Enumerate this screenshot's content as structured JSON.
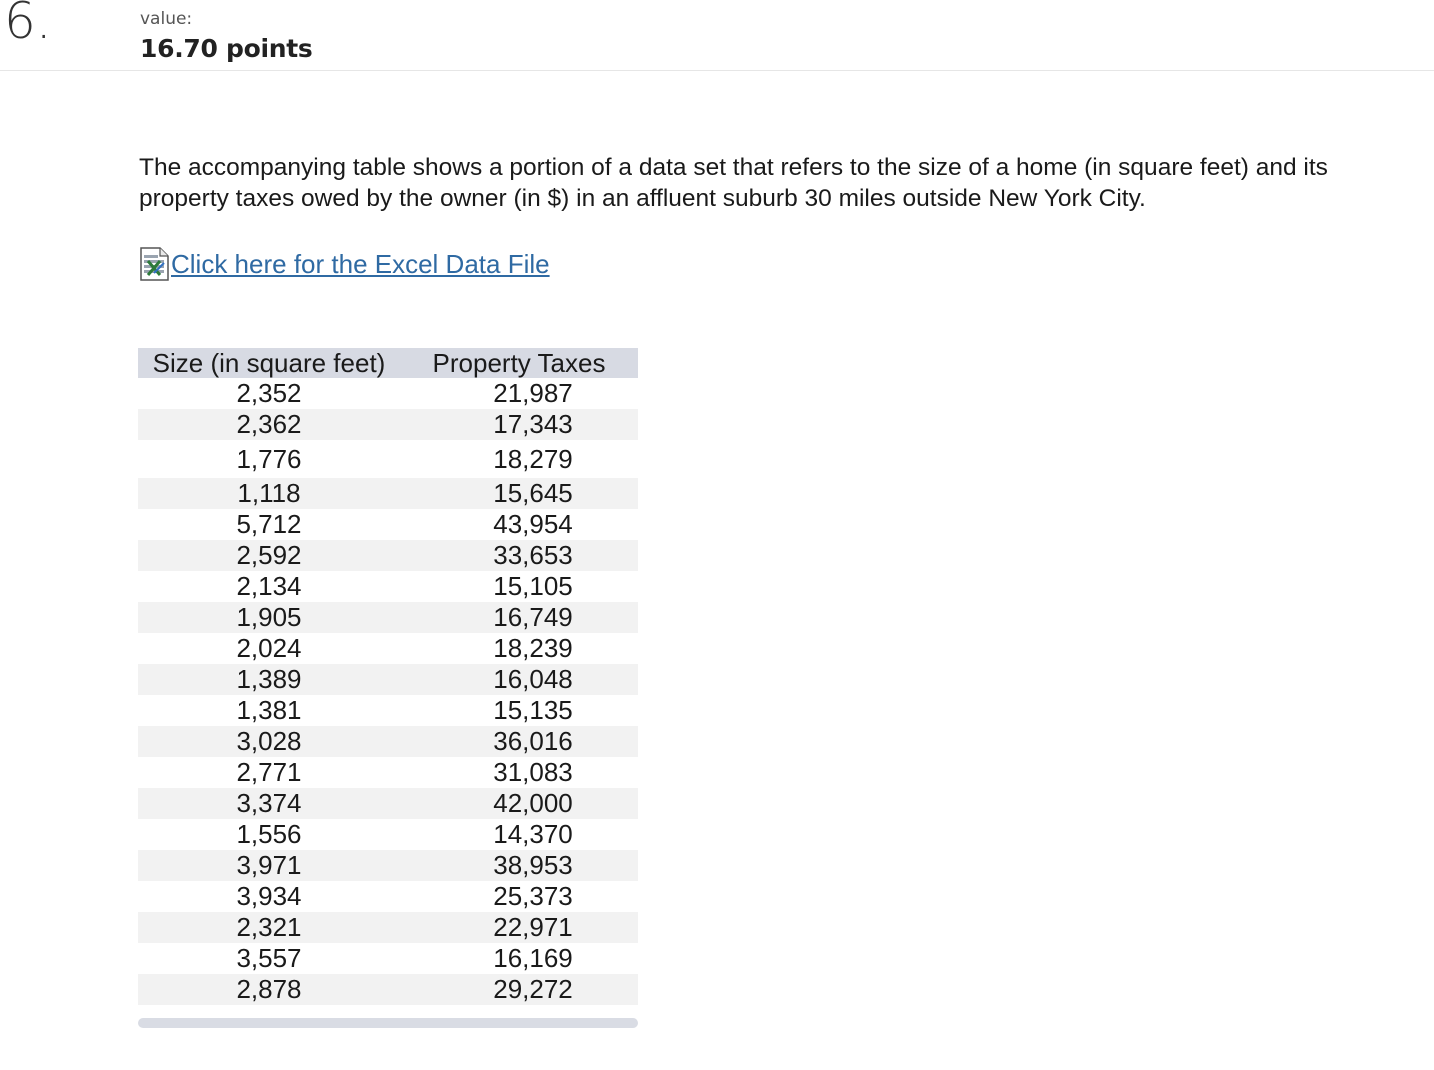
{
  "question": {
    "number": "6.",
    "value_label": "value:",
    "points": "16.70 points"
  },
  "prompt": "The accompanying table shows a portion of a data set that refers to the size of a home (in square feet) and its property taxes owed by the owner (in $) in an affluent suburb 30 miles outside New York City.",
  "excel_link": {
    "label": "Click here for the Excel Data File",
    "icon": "excel-file-icon"
  },
  "table": {
    "headers": [
      "Size (in square feet)",
      "Property Taxes"
    ],
    "rows": [
      [
        "2,352",
        "21,987"
      ],
      [
        "2,362",
        "17,343"
      ],
      [
        "1,776",
        "18,279"
      ],
      [
        "1,118",
        "15,645"
      ],
      [
        "5,712",
        "43,954"
      ],
      [
        "2,592",
        "33,653"
      ],
      [
        "2,134",
        "15,105"
      ],
      [
        "1,905",
        "16,749"
      ],
      [
        "2,024",
        "18,239"
      ],
      [
        "1,389",
        "16,048"
      ],
      [
        "1,381",
        "15,135"
      ],
      [
        "3,028",
        "36,016"
      ],
      [
        "2,771",
        "31,083"
      ],
      [
        "3,374",
        "42,000"
      ],
      [
        "1,556",
        "14,370"
      ],
      [
        "3,971",
        "38,953"
      ],
      [
        "3,934",
        "25,373"
      ],
      [
        "2,321",
        "22,971"
      ],
      [
        "3,557",
        "16,169"
      ],
      [
        "2,878",
        "29,272"
      ]
    ]
  },
  "colors": {
    "header_bg": "#d7dae3",
    "stripe_bg": "#f2f2f2",
    "link": "#2f6aa3"
  }
}
